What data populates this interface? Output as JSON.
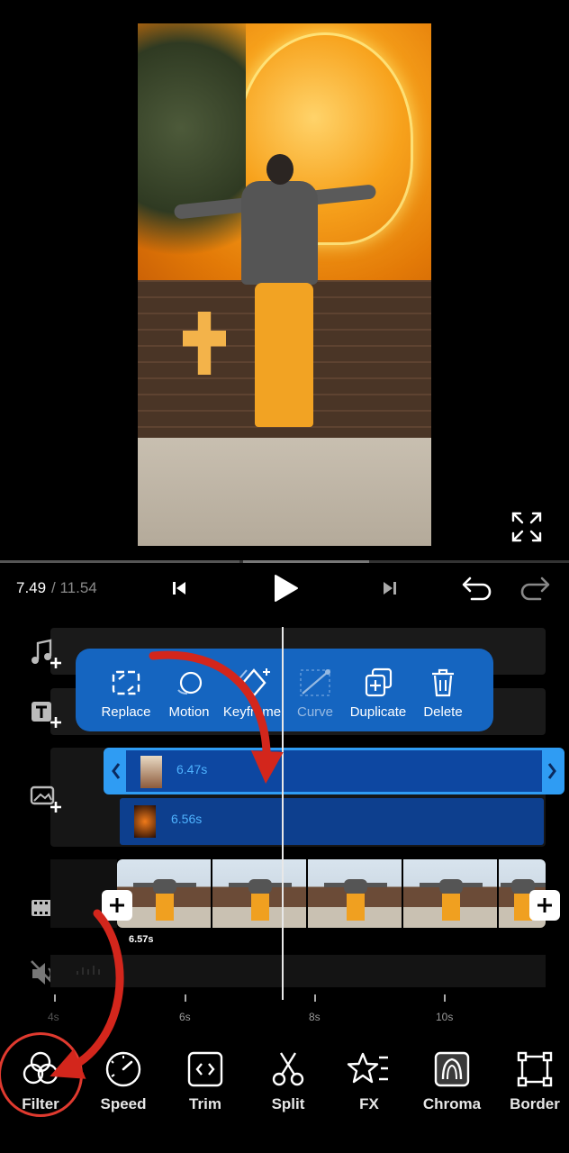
{
  "playback": {
    "current_time": "7.49",
    "total_time": " / 11.54"
  },
  "popup_menu": {
    "items": [
      {
        "label": "Replace",
        "icon": "replace-icon"
      },
      {
        "label": "Motion",
        "icon": "motion-icon"
      },
      {
        "label": "Keyframe",
        "icon": "keyframe-icon"
      },
      {
        "label": "Curve",
        "icon": "curve-icon"
      },
      {
        "label": "Duplicate",
        "icon": "duplicate-icon"
      },
      {
        "label": "Delete",
        "icon": "delete-icon"
      }
    ]
  },
  "tracks": {
    "overlay1_duration": "6.47s",
    "overlay2_duration": "6.56s",
    "video_duration": "6.57s"
  },
  "ruler": {
    "labels": [
      "4s",
      "6s",
      "8s",
      "10s"
    ]
  },
  "toolbar": {
    "items": [
      {
        "label": "Filter",
        "icon": "filter-icon"
      },
      {
        "label": "Speed",
        "icon": "speed-icon"
      },
      {
        "label": "Trim",
        "icon": "trim-icon"
      },
      {
        "label": "Split",
        "icon": "split-icon"
      },
      {
        "label": "FX",
        "icon": "fx-icon"
      },
      {
        "label": "Chroma",
        "icon": "chroma-icon"
      },
      {
        "label": "Border",
        "icon": "border-icon"
      }
    ]
  },
  "colors": {
    "accent_blue": "#1565c0",
    "selection_blue": "#2f9cf3",
    "annotation_red": "#e03a2f"
  }
}
